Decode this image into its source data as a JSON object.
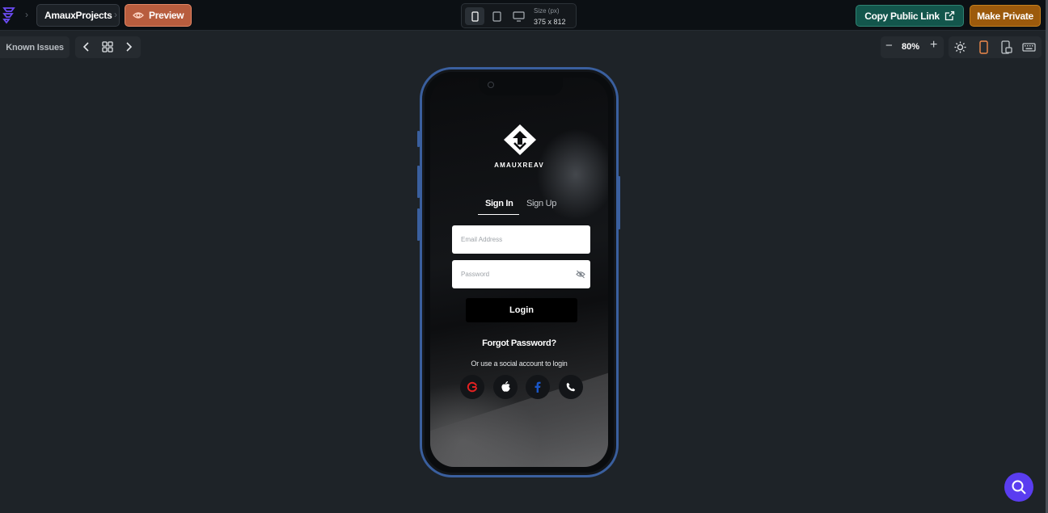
{
  "topbar": {
    "project_name": "AmauxProjects",
    "preview_label": "Preview",
    "size_label": "Size (px)",
    "size_value": "375 x 812",
    "copy_link_label": "Copy Public Link",
    "make_private_label": "Make Private"
  },
  "toolbar": {
    "known_issues_label": "Known Issues",
    "zoom_value": "80%",
    "zoom_minus": "−",
    "zoom_plus": "+"
  },
  "screen": {
    "brand_name": "AMAUXREAV",
    "tabs": [
      {
        "label": "Sign In",
        "active": true
      },
      {
        "label": "Sign Up",
        "active": false
      }
    ],
    "email_placeholder": "Email Address",
    "password_placeholder": "Password",
    "login_label": "Login",
    "forgot_label": "Forgot Password?",
    "social_text": "Or use a social account to login",
    "social_icons": [
      "google-icon",
      "apple-icon",
      "facebook-icon",
      "phone-icon"
    ]
  },
  "colors": {
    "accent_preview": "#b85d3e",
    "copy_link_bg": "#13564c",
    "make_private_bg": "#9c5a0c",
    "phone_frame": "#3a5f9e",
    "fab": "#5a3df0",
    "google_red": "#e32121",
    "facebook_blue": "#1a56c8",
    "active_device": "#f08a4b"
  }
}
